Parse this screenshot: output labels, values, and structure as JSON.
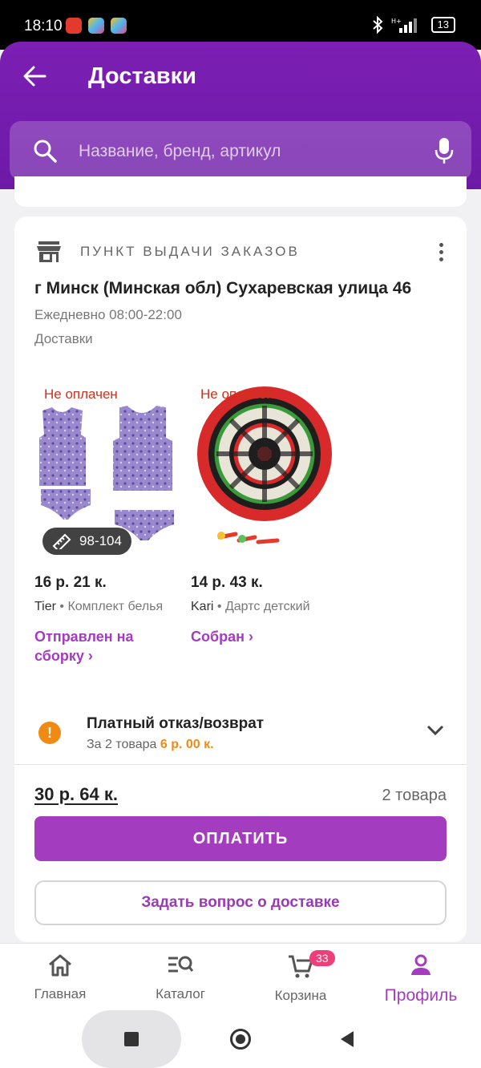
{
  "status_bar": {
    "time": "18:10",
    "battery": "13"
  },
  "header": {
    "title": "Доставки"
  },
  "search": {
    "placeholder": "Название, бренд, артикул"
  },
  "pickup": {
    "label": "ПУНКТ ВЫДАЧИ ЗАКАЗОВ",
    "address": "г Минск (Минская обл) Сухаревская улица 46",
    "hours": "Ежедневно 08:00-22:00",
    "section": "Доставки"
  },
  "products": [
    {
      "payment": "Не оплачен",
      "size": "98-104",
      "price": "16 р. 21 к.",
      "brand": "Tier",
      "name": " • Комплект белья",
      "status": "Отправлен на сборку ›"
    },
    {
      "payment": "Не оплачен",
      "price": "14 р. 43 к.",
      "brand": "Kari",
      "name": " • Дартс детский",
      "status": "Собран ›"
    }
  ],
  "refund": {
    "title": "Платный отказ/возврат",
    "subtitle": "За 2 товара ",
    "amount": "6 р. 00 к."
  },
  "summary": {
    "total": "30 р. 64 к.",
    "count": "2 товара"
  },
  "buttons": {
    "pay": "ОПЛАТИТЬ",
    "ask": "Задать вопрос о доставке"
  },
  "nav": {
    "home": "Главная",
    "catalog": "Каталог",
    "cart": "Корзина",
    "cart_badge": "33",
    "profile": "Профиль"
  },
  "colors": {
    "brand": "#7c1fb4",
    "accent": "#a43cbf",
    "warning": "#f08a14",
    "unpaid": "#d0311c"
  }
}
